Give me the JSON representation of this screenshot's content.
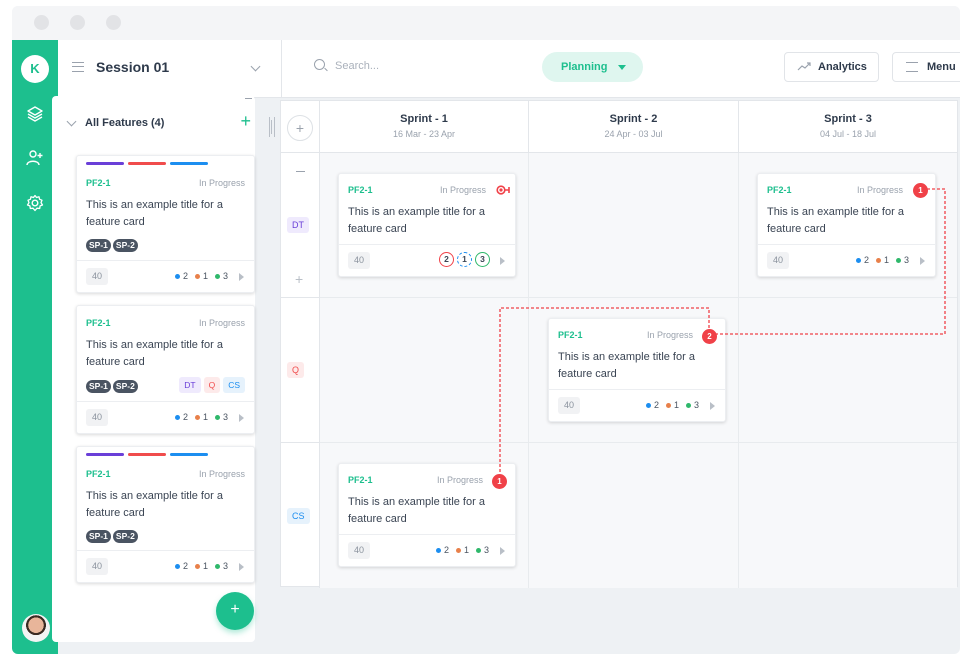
{
  "header": {
    "session_title": "Session 01",
    "search_placeholder": "Search...",
    "mode_label": "Planning",
    "analytics_label": "Analytics",
    "menu_label": "Menu"
  },
  "rail": {
    "user_initial": "K",
    "icons": [
      "layers-icon",
      "add-user-icon",
      "settings-icon"
    ]
  },
  "features_panel": {
    "title": "All Features (4)",
    "cards": [
      {
        "id": "PF2-1",
        "status": "In Progress",
        "title": "This is an example title for a feature card",
        "tags": [
          "SP-1",
          "SP-2"
        ],
        "teams": [],
        "points": "40",
        "counts": [
          "2",
          "1",
          "3"
        ],
        "color_bars": [
          "#6a3fd8",
          "#f04c4c",
          "#1c8ef0"
        ]
      },
      {
        "id": "PF2-1",
        "status": "In Progress",
        "title": "This is an example title for a feature card",
        "tags": [
          "SP-1",
          "SP-2"
        ],
        "teams": [
          "DT",
          "Q",
          "CS"
        ],
        "points": "40",
        "counts": [
          "2",
          "1",
          "3"
        ],
        "color_bars": []
      },
      {
        "id": "PF2-1",
        "status": "In Progress",
        "title": "This is an example title for a feature card",
        "tags": [
          "SP-1",
          "SP-2"
        ],
        "teams": [],
        "points": "40",
        "counts": [
          "2",
          "1",
          "3"
        ],
        "color_bars": [
          "#6a3fd8",
          "#f04c4c",
          "#1c8ef0"
        ]
      }
    ]
  },
  "board": {
    "sprints": [
      {
        "name": "Sprint - 1",
        "dates": "16 Mar - 23 Apr"
      },
      {
        "name": "Sprint - 2",
        "dates": "24 Apr - 03 Jul"
      },
      {
        "name": "Sprint - 3",
        "dates": "04 Jul - 18 Jul"
      }
    ],
    "teams": [
      {
        "label": "DT",
        "bg": "#efeafd",
        "fg": "#6a3fd8"
      },
      {
        "label": "Q",
        "bg": "#fdeaea",
        "fg": "#f04c4c"
      },
      {
        "label": "CS",
        "bg": "#e6f2fc",
        "fg": "#1c8ef0"
      }
    ],
    "cards": [
      {
        "id": "PF2-1",
        "status": "In Progress",
        "title": "This is an example title for a feature card",
        "points": "40",
        "rings": [
          "2",
          "1",
          "3"
        ],
        "flag": "dependency-icon"
      },
      {
        "id": "PF2-1",
        "status": "In Progress",
        "title": "This is an example title for a feature card",
        "points": "40",
        "counts": [
          "2",
          "1",
          "3"
        ],
        "badge": "1"
      },
      {
        "id": "PF2-1",
        "status": "In Progress",
        "title": "This is an example title for a feature card",
        "points": "40",
        "counts": [
          "2",
          "1",
          "3"
        ],
        "badge": "2"
      },
      {
        "id": "PF2-1",
        "status": "In Progress",
        "title": "This is an example title for a feature card",
        "points": "40",
        "counts": [
          "2",
          "1",
          "3"
        ],
        "badge": "1"
      }
    ]
  },
  "colors": {
    "accent": "#1dbf8e",
    "danger": "#f04148",
    "blue": "#1c8ef0",
    "orange": "#e8804a",
    "green": "#2fb86b"
  }
}
